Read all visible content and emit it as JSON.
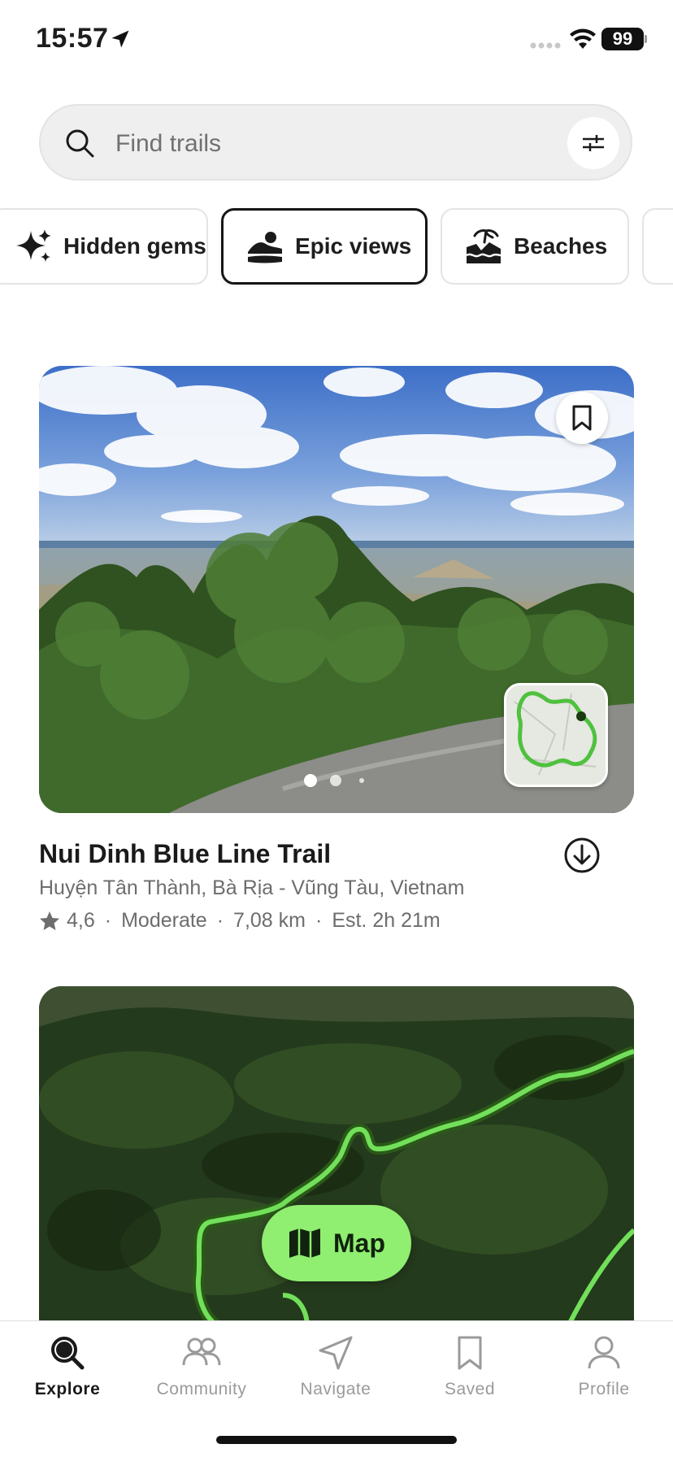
{
  "status_bar": {
    "time": "15:57",
    "battery": "99"
  },
  "search": {
    "placeholder": "Find trails"
  },
  "chips": [
    {
      "label": "Hidden gems",
      "icon": "sparkles-icon"
    },
    {
      "label": "Epic views",
      "icon": "mountain-view-icon",
      "selected": true
    },
    {
      "label": "Beaches",
      "icon": "beach-icon"
    }
  ],
  "trail_card": {
    "title": "Nui Dinh Blue Line Trail",
    "location": "Huyện Tân Thành, Bà Rịa - Vũng Tàu, Vietnam",
    "rating": "4,6",
    "difficulty": "Moderate",
    "distance": "7,08 km",
    "est_time": "Est. 2h 21m",
    "meta_separator": "·",
    "photo_count": 3,
    "active_photo": 1
  },
  "map_button": {
    "label": "Map"
  },
  "tab_bar": {
    "tabs": [
      {
        "label": "Explore",
        "active": true
      },
      {
        "label": "Community"
      },
      {
        "label": "Navigate"
      },
      {
        "label": "Saved"
      },
      {
        "label": "Profile"
      }
    ]
  },
  "colors": {
    "accent_green": "#90ee70",
    "route_green": "#6fe25a",
    "text_dark": "#1a1a1a",
    "text_muted": "#6d6d6d"
  }
}
